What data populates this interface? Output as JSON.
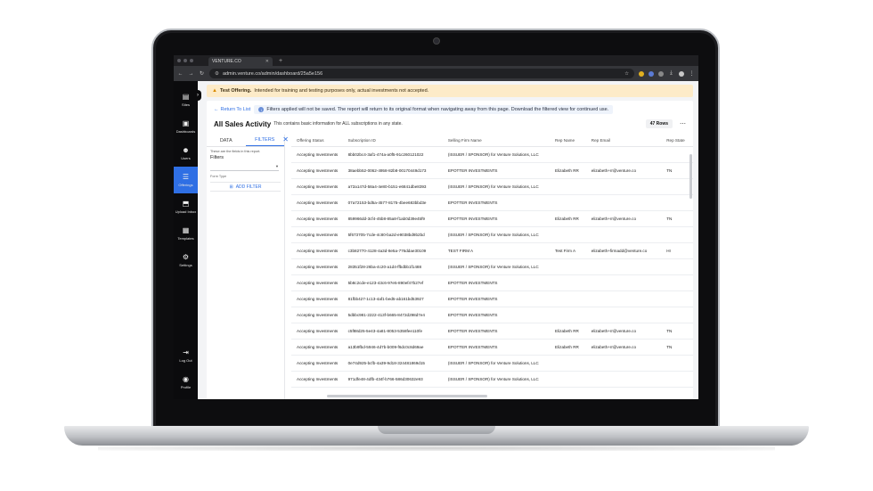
{
  "browser": {
    "tab_title": "VENTURE.CO",
    "new_tab": "+",
    "url": "admin.venture.co/admin/dashboard/25a5e156"
  },
  "sidebar": {
    "items": [
      {
        "label": "Sites",
        "icon": "building-icon"
      },
      {
        "label": "Dashboards",
        "icon": "chart-icon"
      },
      {
        "label": "Users",
        "icon": "users-icon"
      },
      {
        "label": "Offerings",
        "icon": "sliders-icon",
        "active": true
      },
      {
        "label": "Upload Inbox",
        "icon": "upload-icon"
      },
      {
        "label": "Templates",
        "icon": "template-icon"
      },
      {
        "label": "Settings",
        "icon": "gear-icon"
      }
    ],
    "bottom": [
      {
        "label": "Log Out",
        "icon": "logout-icon"
      },
      {
        "label": "Profile",
        "icon": "profile-icon"
      }
    ]
  },
  "banner": {
    "bold": "Test Offering.",
    "text": "Intended for training and testing purposes only, actual investments not accepted."
  },
  "toolbar": {
    "back_label": "Return To List",
    "info_text": "Filters applied will not be saved. The report will return to its original format when navigating away from this page. Download the filtered view for continued use."
  },
  "report": {
    "title": "All Sales Activity",
    "subtitle": "This contains basic information for ALL subscriptions in any state.",
    "rows_badge": "47 Rows"
  },
  "filters": {
    "tab_data": "DATA",
    "tab_filters": "FILTERS",
    "note": "These are the fields in this report.",
    "label": "Filters",
    "field_label": "Form Type",
    "add_filter": "ADD FILTER"
  },
  "table": {
    "headers": [
      "Offering Status",
      "Subscription ID",
      "Selling Firm Name",
      "Rep Name",
      "Rep Email",
      "Rep State"
    ],
    "rows": [
      [
        "Accepting Investments",
        "8bb02bc4-3af1-474a-a0f5-91c260121022",
        "(ISSUER / SPONSOR) for Venture Solutions, LLC",
        "",
        "",
        ""
      ],
      [
        "Accepting Investments",
        "38aebb52-0062-4958-82b8-00170449d173",
        "EPOTTER INVESTMENTS",
        "Elizabeth RR",
        "elizabeth+rr@venture.co",
        "TN"
      ],
      [
        "Accepting Investments",
        "a72a147d-58a4-4e80-b151-e6841dbe8393",
        "(ISSUER / SPONSOR) for Venture Solutions, LLC",
        "",
        "",
        ""
      ],
      [
        "Accepting Investments",
        "07a72153-bd5a-4577-8175-4bee683bbd3e",
        "EPOTTER INVESTMENTS",
        "",
        "",
        ""
      ],
      [
        "Accepting Investments",
        "859966dd-3cf4-45b8-85a8-f1ab0d39e45f9",
        "EPOTTER INVESTMENTS",
        "Elizabeth RR",
        "elizabeth+rr@venture.co",
        "TN"
      ],
      [
        "Accepting Investments",
        "5f673705-7cde-4c80-ba2d-e9038bd9b2bd",
        "(ISSUER / SPONSOR) for Venture Solutions, LLC",
        "",
        "",
        ""
      ],
      [
        "Accepting Investments",
        "c3b82770-4128-4a3d-8e5a-776ddae30109",
        "TEST FIRM A",
        "Test Firm A",
        "elizabeth+firmadd@venture.co",
        "HI"
      ],
      [
        "Accepting Investments",
        "28351f28-26ba-4c20-a1d4-ffbdbb1f1488",
        "(ISSUER / SPONSOR) for Venture Solutions, LLC",
        "",
        "",
        ""
      ],
      [
        "Accepting Investments",
        "5b8c2cde-e123-43c6-97e5-890ef47b27ef",
        "EPOTTER INVESTMENTS",
        "",
        "",
        ""
      ],
      [
        "Accepting Investments",
        "81fbb427-1c13-4af1-bed5-ab161bd53927",
        "EPOTTER INVESTMENTS",
        "",
        "",
        ""
      ],
      [
        "Accepting Investments",
        "5dbbc981-2222-413f-b665-8472d298d7e4",
        "EPOTTER INVESTMENTS",
        "",
        "",
        ""
      ],
      [
        "Accepting Investments",
        "c5f88d25-5e43-4a81-8053-5358fee110fe",
        "EPOTTER INVESTMENTS",
        "Elizabeth RR",
        "elizabeth+rr@venture.co",
        "TN"
      ],
      [
        "Accepting Investments",
        "a13b9fbd-5946-4d7b-b009-f6dc0c8d69ae",
        "EPOTTER INVESTMENTS",
        "Elizabeth RR",
        "elizabeth+rr@venture.co",
        "TN"
      ],
      [
        "Accepting Investments",
        "0e74d925-bcfb-4a39-9d18-324481869d15",
        "(ISSUER / SPONSOR) for Venture Solutions, LLC",
        "",
        "",
        ""
      ],
      [
        "Accepting Investments",
        "971dfe48-4dfb-434f-b766-586d30632e93",
        "(ISSUER / SPONSOR) for Venture Solutions, LLC",
        "",
        "",
        ""
      ]
    ]
  },
  "colors": {
    "accent": "#2f6fe4",
    "banner_bg": "#fdebc8",
    "sidebar_bg": "#0b0b0d"
  }
}
